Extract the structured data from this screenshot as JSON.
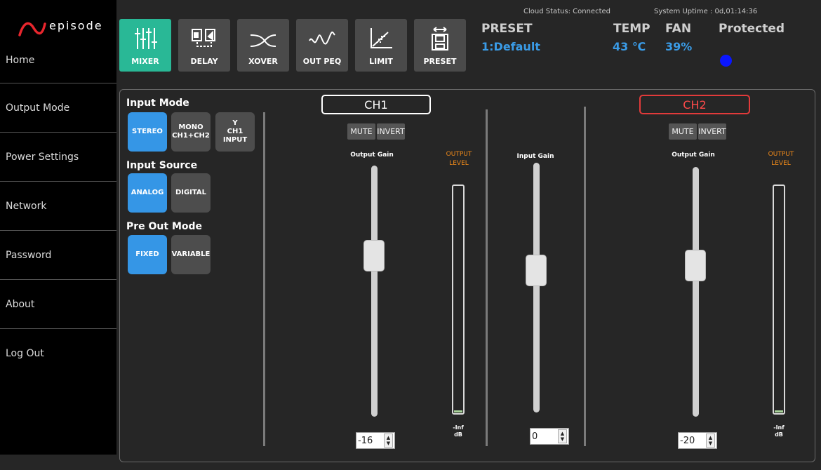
{
  "brand": {
    "logo_text": "episode",
    "logo_color": "#e8262d"
  },
  "sidebar": {
    "items": [
      {
        "label": "Home"
      },
      {
        "label": "Output Mode"
      },
      {
        "label": "Power Settings"
      },
      {
        "label": "Network"
      },
      {
        "label": "Password"
      },
      {
        "label": "About"
      },
      {
        "label": "Log Out"
      }
    ]
  },
  "toolbar": {
    "tools": [
      {
        "label": "MIXER",
        "icon": "mixer-icon",
        "active": true
      },
      {
        "label": "DELAY",
        "icon": "delay-icon",
        "active": false
      },
      {
        "label": "XOVER",
        "icon": "xover-icon",
        "active": false
      },
      {
        "label": "OUT PEQ",
        "icon": "peq-icon",
        "active": false
      },
      {
        "label": "LIMIT",
        "icon": "limit-icon",
        "active": false
      },
      {
        "label": "PRESET",
        "icon": "preset-icon",
        "active": false
      }
    ],
    "active_color": "#29b896"
  },
  "status": {
    "cloud": "Cloud Status: Connected",
    "uptime": "System Uptime : 0d,01:14:36",
    "preset_label": "PRESET",
    "preset_value": "1:Default",
    "temp_label": "TEMP",
    "temp_value": "43 ℃",
    "fan_label": "FAN",
    "fan_value": "39%",
    "protected_label": "Protected",
    "protected_indicator_color": "#0a16ff"
  },
  "settings": {
    "input_mode": {
      "title": "Input Mode",
      "options": [
        {
          "line1": "STEREO",
          "line2": "",
          "selected": true
        },
        {
          "line1": "MONO",
          "line2": "CH1+CH2",
          "selected": false
        },
        {
          "line1": "Y",
          "line2": "CH1 INPUT",
          "selected": false
        }
      ]
    },
    "input_source": {
      "title": "Input Source",
      "options": [
        {
          "line1": "ANALOG",
          "selected": true
        },
        {
          "line1": "DIGITAL",
          "selected": false
        }
      ]
    },
    "pre_out_mode": {
      "title": "Pre Out Mode",
      "options": [
        {
          "line1": "FIXED",
          "selected": true
        },
        {
          "line1": "VARIABLE",
          "selected": false
        }
      ]
    }
  },
  "ch1": {
    "name": "CH1",
    "mute_label": "MUTE",
    "invert_label": "INVERT",
    "output_gain_label": "Output Gain",
    "output_gain_value": "-16",
    "output_gain_fraction": 0.34,
    "output_level_label": "OUTPUT LEVEL",
    "meter_label_1": "-Inf",
    "meter_label_2": "dB"
  },
  "input": {
    "gain_label": "Input Gain",
    "gain_value": "0",
    "gain_fraction": 0.42
  },
  "ch2": {
    "name": "CH2",
    "mute_label": "MUTE",
    "invert_label": "INVERT",
    "output_gain_label": "Output Gain",
    "output_gain_value": "-20",
    "output_gain_fraction": 0.38,
    "output_level_label": "OUTPUT LEVEL",
    "meter_label_1": "-Inf",
    "meter_label_2": "dB"
  }
}
